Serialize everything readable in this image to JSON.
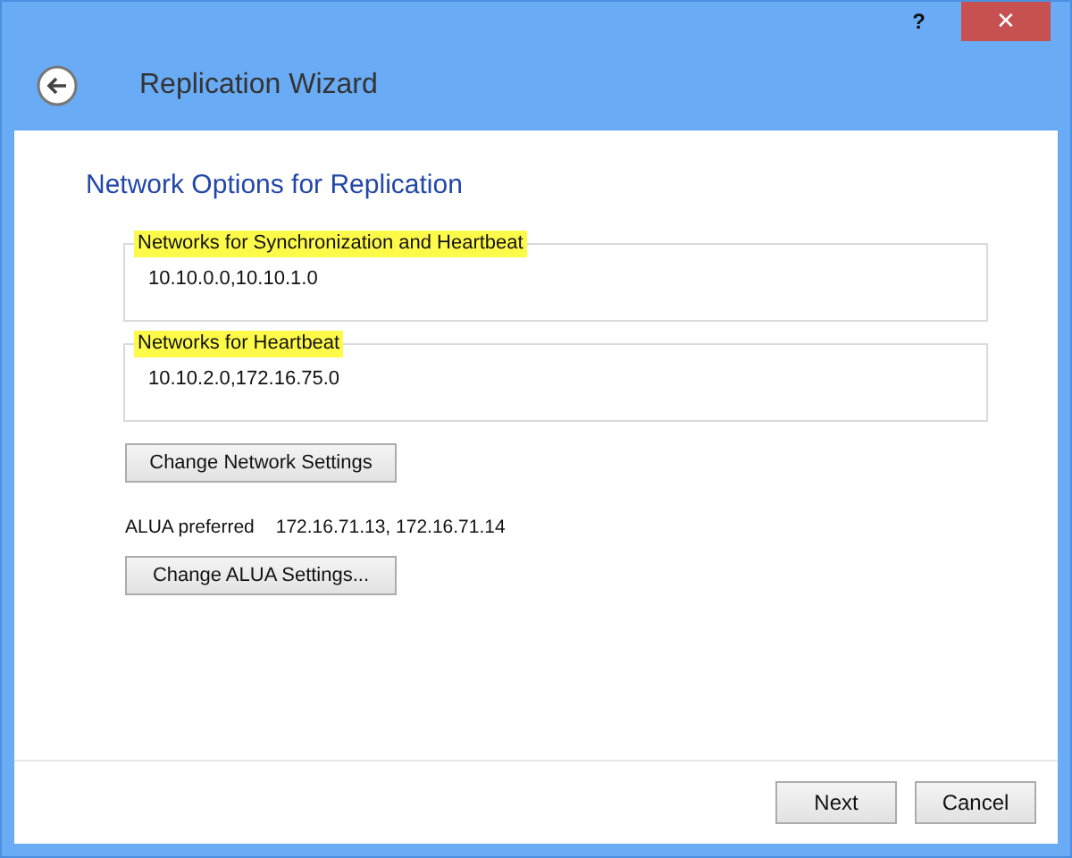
{
  "window": {
    "help": "?",
    "close": "✕",
    "title": "Replication Wizard"
  },
  "page": {
    "heading": "Network Options for Replication"
  },
  "groups": [
    {
      "legend": "Networks for Synchronization and Heartbeat",
      "highlighted": true,
      "value": "10.10.0.0,10.10.1.0"
    },
    {
      "legend": "Networks for Heartbeat",
      "highlighted": true,
      "value": "10.10.2.0,172.16.75.0"
    }
  ],
  "change_network_button": "Change Network Settings",
  "alua": {
    "label": "ALUA preferred",
    "value": "172.16.71.13, 172.16.71.14"
  },
  "change_alua_button": "Change ALUA Settings...",
  "buttons": [
    "Next",
    "Cancel"
  ]
}
